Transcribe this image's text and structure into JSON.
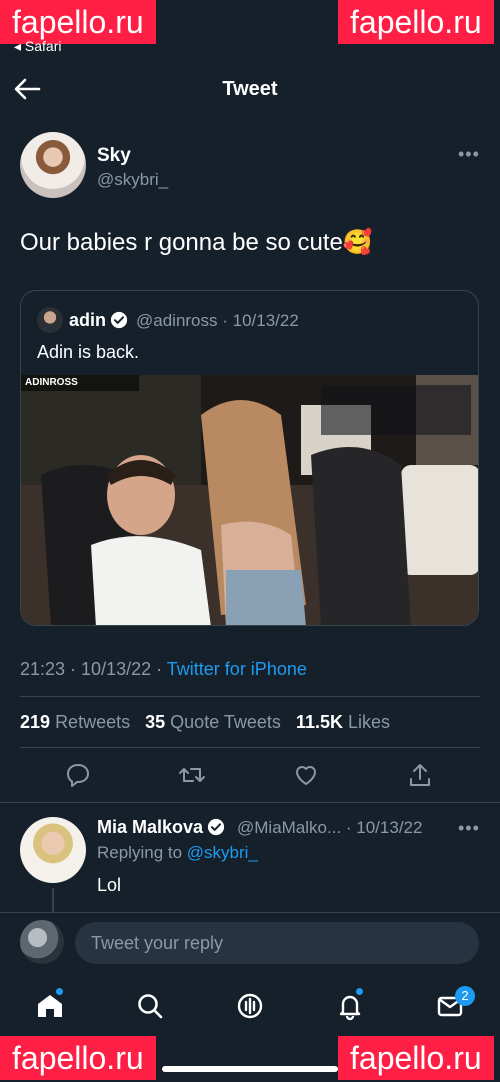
{
  "watermarks": [
    "fapello.ru",
    "fapello.ru",
    "fapello.ru",
    "fapello.ru"
  ],
  "status_bar": {
    "back_app": "◂ Safari"
  },
  "header": {
    "title": "Tweet"
  },
  "tweet": {
    "author_name": "Sky",
    "author_handle": "@skybri_",
    "text": "Our babies r gonna be so cute🥰",
    "quoted": {
      "author_name": "adin",
      "author_handle": "@adinross",
      "date": "10/13/22",
      "text": "Adin is back.",
      "stream_tag": "ADINROSS"
    },
    "time": "21:23",
    "date": "10/13/22",
    "source": "Twitter for iPhone",
    "stats": {
      "retweets_count": "219",
      "retweets_label": "Retweets",
      "quotes_count": "35",
      "quotes_label": "Quote Tweets",
      "likes_count": "11.5K",
      "likes_label": "Likes"
    }
  },
  "actions": [
    "reply-icon",
    "retweet-icon",
    "like-icon",
    "share-icon"
  ],
  "reply": {
    "author_name": "Mia Malkova",
    "meta": "@MiaMalko... · 10/13/22",
    "replying_prefix": "Replying to ",
    "replying_handle": "@skybri_",
    "text": "Lol"
  },
  "composer": {
    "placeholder": "Tweet your reply"
  },
  "tabbar": {
    "icons": [
      "home-icon",
      "search-icon",
      "spaces-icon",
      "notifications-icon",
      "messages-icon"
    ],
    "messages_badge": "2"
  },
  "colors": {
    "background": "#15202b",
    "accent": "#1d9bf0",
    "secondary_text": "#8b98a5",
    "border": "#38444d",
    "watermark": "#ff1f45"
  }
}
